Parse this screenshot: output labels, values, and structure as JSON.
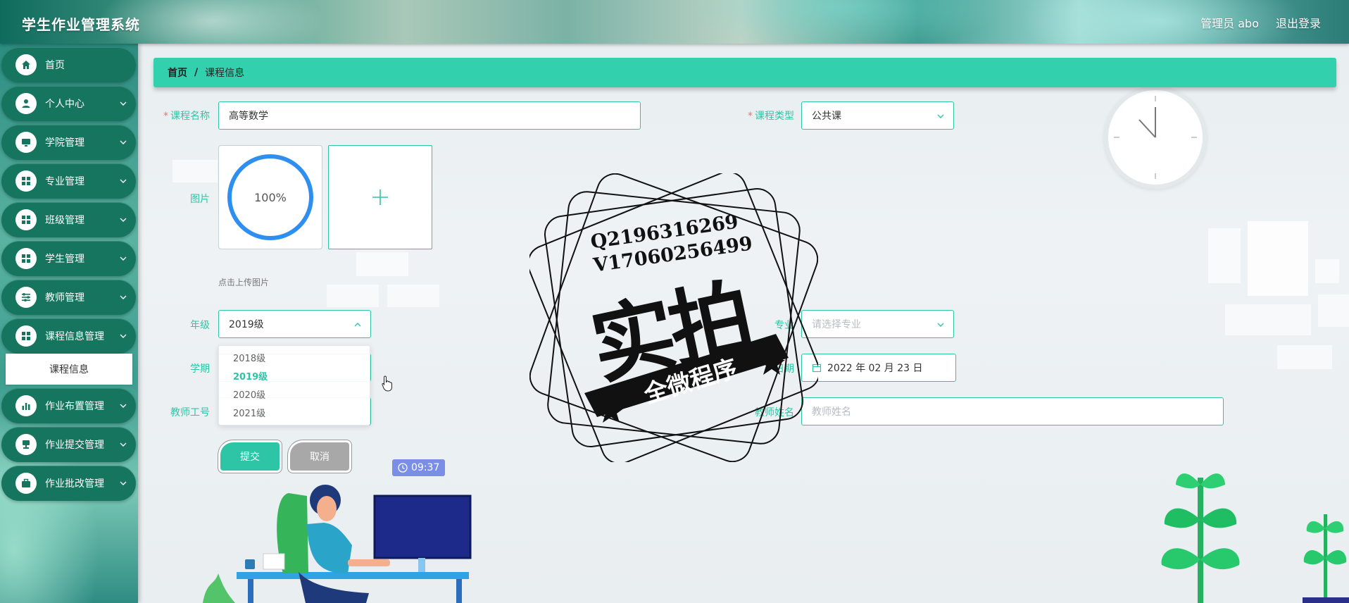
{
  "header": {
    "app_title": "学生作业管理系统",
    "user_label": "管理员 abo",
    "logout_label": "退出登录"
  },
  "sidebar": {
    "items": [
      {
        "label": "首页",
        "icon": "home-icon"
      },
      {
        "label": "个人中心",
        "icon": "person-icon"
      },
      {
        "label": "学院管理",
        "icon": "monitor-icon"
      },
      {
        "label": "专业管理",
        "icon": "grid-icon"
      },
      {
        "label": "班级管理",
        "icon": "grid-icon"
      },
      {
        "label": "学生管理",
        "icon": "grid-icon"
      },
      {
        "label": "教师管理",
        "icon": "sliders-icon"
      },
      {
        "label": "课程信息管理",
        "icon": "grid-icon"
      },
      {
        "label": "作业布置管理",
        "icon": "bar-chart-icon"
      },
      {
        "label": "作业提交管理",
        "icon": "stamp-icon"
      },
      {
        "label": "作业批改管理",
        "icon": "briefcase-icon"
      }
    ],
    "active_sub": "课程信息"
  },
  "breadcrumb": {
    "home": "首页",
    "separator": "/",
    "current": "课程信息"
  },
  "form": {
    "course_name": {
      "label": "课程名称",
      "value": "高等数学"
    },
    "course_type": {
      "label": "课程类型",
      "value": "公共课"
    },
    "image": {
      "label": "图片",
      "progress": "100%",
      "hint": "点击上传图片"
    },
    "grade": {
      "label": "年级",
      "value": "2019级",
      "options": [
        "2018级",
        "2019级",
        "2020级",
        "2021级"
      ]
    },
    "major": {
      "label": "专业",
      "placeholder": "请选择专业"
    },
    "semester": {
      "label": "学期"
    },
    "date": {
      "label": "日期",
      "value": "2022 年 02 月 23 日"
    },
    "teacher_id": {
      "label": "教师工号"
    },
    "teacher_name": {
      "label": "教师姓名",
      "placeholder": "教师姓名"
    },
    "submit_label": "提交",
    "cancel_label": "取消"
  },
  "timer": "09:37",
  "watermark": {
    "line1": "Q2196316269",
    "line2": "V17060256499",
    "main": "实拍",
    "banner": "全微程序"
  },
  "colors": {
    "accent": "#2ec5a7",
    "sidebar_button": "#16755f",
    "breadcrumb_bg": "#33d0ae"
  }
}
